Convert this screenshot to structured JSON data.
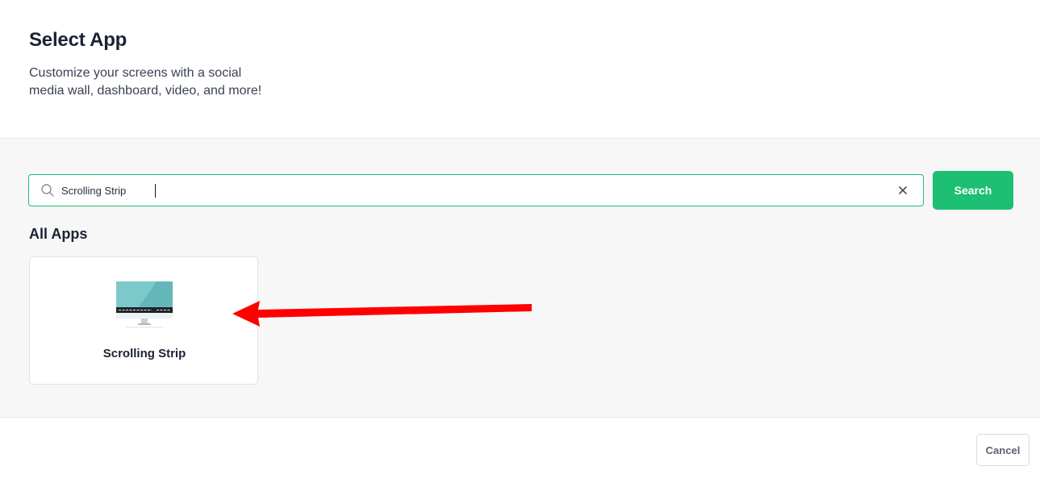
{
  "header": {
    "title": "Select App",
    "subtitle": "Customize your screens with a social media wall, dashboard, video, and more!"
  },
  "search": {
    "value": "Scrolling Strip",
    "button_label": "Search",
    "search_icon": "search-icon",
    "clear_icon": "close-icon"
  },
  "apps_section": {
    "title": "All Apps",
    "apps": [
      {
        "name": "Scrolling Strip",
        "icon": "monitor-icon"
      }
    ]
  },
  "footer": {
    "cancel_label": "Cancel"
  },
  "colors": {
    "accent": "#1dbf73",
    "arrow": "#ff0000"
  }
}
